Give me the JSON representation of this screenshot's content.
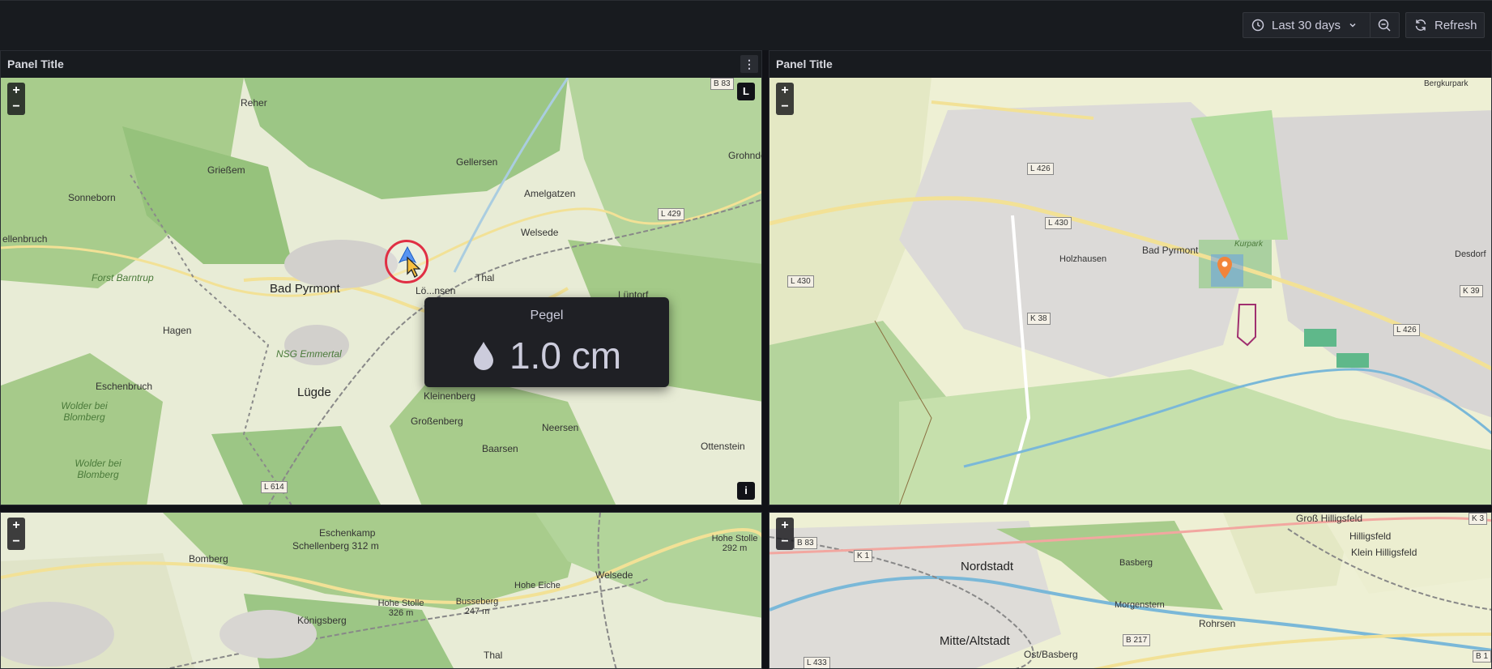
{
  "toolbar": {
    "time_range": "Last 30 days",
    "refresh": "Refresh"
  },
  "panels": [
    {
      "title": "Panel Title"
    },
    {
      "title": "Panel Title"
    }
  ],
  "tooltip": {
    "title": "Pegel",
    "value": "1.0 cm"
  },
  "map1": {
    "layer_badge": "L",
    "info_badge": "i",
    "labels": [
      "Reher",
      "Grießem",
      "Gellersen",
      "Grohnde",
      "Sonneborn",
      "Amelgatzen",
      "ellenbruch",
      "Welsede",
      "Forst Barntrup",
      "Bad Pyrmont",
      "Thal",
      "Lüntorf",
      "Hagen",
      "NSG Emmertal",
      "Eschenbruch",
      "Lügde",
      "Kleinenberg",
      "Wolder bei Blomberg",
      "Großenberg",
      "Neersen",
      "Baarsen",
      "Ottenstein",
      "Wolder bei Blomberg",
      "Lö...nsen"
    ],
    "roads": [
      "B 83",
      "L 429",
      "L 614"
    ]
  },
  "map2": {
    "labels": [
      "Bergkurpark",
      "Bad Pyrmont",
      "Holzhausen",
      "Desdorf",
      "Kurpark"
    ],
    "roads": [
      "L 426",
      "L 430",
      "L 430",
      "K 38",
      "L 426",
      "K 39"
    ]
  },
  "map3": {
    "labels": [
      "Eschenkamp",
      "Schellenberg 312 m",
      "Bomberg",
      "Hohe Stolle 292 m",
      "Welsede",
      "Hohe Stolle 326 m",
      "Busseberg 247 m",
      "Hohe Eiche",
      "Königsberg",
      "Thal"
    ]
  },
  "map4": {
    "labels": [
      "Groß Hilligsfeld",
      "Hilligsfeld",
      "Klein Hilligsfeld",
      "Nordstadt",
      "Basberg",
      "Morgenstern",
      "Rohrsen",
      "Mitte/Altstadt",
      "Ost/Basberg"
    ],
    "roads": [
      "B 83",
      "K 1",
      "K 3",
      "B 217",
      "L 433",
      "B 1"
    ]
  },
  "colors": {
    "accent_blue": "#5794f2",
    "marker_orange": "#f2843a",
    "cursor_ring": "#e02f44"
  }
}
